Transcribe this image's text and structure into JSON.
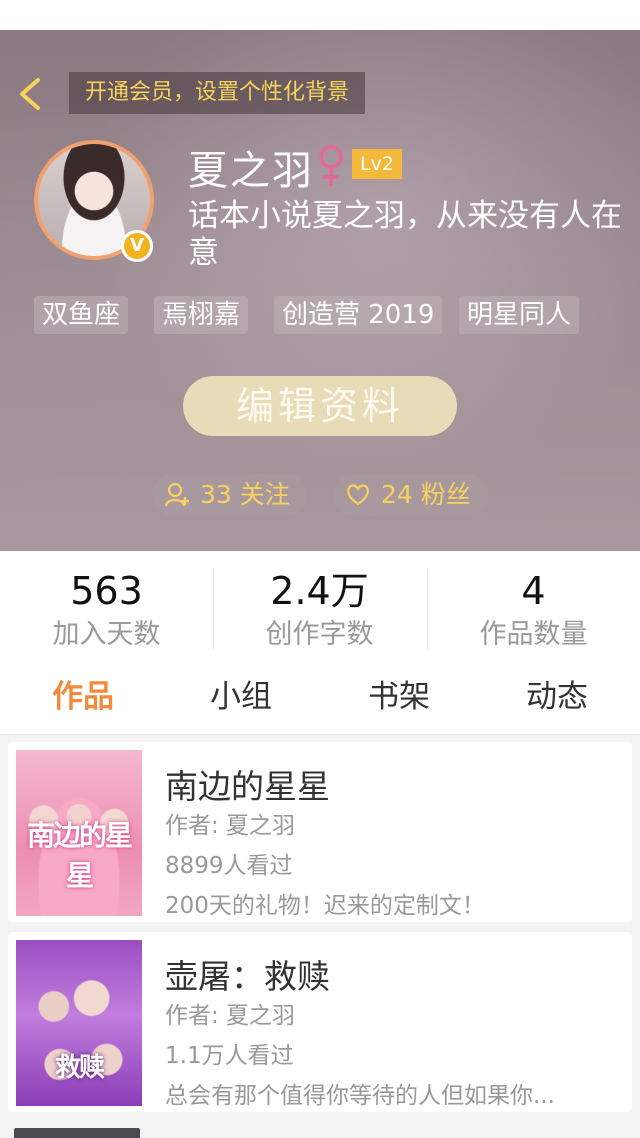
{
  "header": {
    "vip_banner": "开通会员，设置个性化背景"
  },
  "profile": {
    "username": "夏之羽",
    "level": "Lv2",
    "bio": "话本小说夏之羽，从来没有人在意",
    "verified_badge": "V",
    "tags": [
      "双鱼座",
      "焉栩嘉",
      "创造营 2019",
      "明星同人"
    ],
    "edit_button": "编辑资料",
    "following": "33 关注",
    "fans": "24 粉丝",
    "colors": {
      "accent": "#f08a3c",
      "gold": "#f7d35c",
      "level_bg": "#f4b93b",
      "gender": "#e6679b"
    }
  },
  "stats": [
    {
      "value": "563",
      "label": "加入天数"
    },
    {
      "value": "2.4万",
      "label": "创作字数"
    },
    {
      "value": "4",
      "label": "作品数量"
    }
  ],
  "tabs": [
    {
      "label": "作品",
      "active": true
    },
    {
      "label": "小组",
      "active": false
    },
    {
      "label": "书架",
      "active": false
    },
    {
      "label": "动态",
      "active": false
    }
  ],
  "works": [
    {
      "title": "南边的星星",
      "author": "作者: 夏之羽",
      "views": "8899人看过",
      "desc": "200天的礼物！迟来的定制文！",
      "cover_text": "南边的星星"
    },
    {
      "title": "壶屠：救赎",
      "author": "作者: 夏之羽",
      "views": "1.1万人看过",
      "desc": "总会有那个值得你等待的人但如果你...",
      "cover_text": "救赎"
    }
  ]
}
